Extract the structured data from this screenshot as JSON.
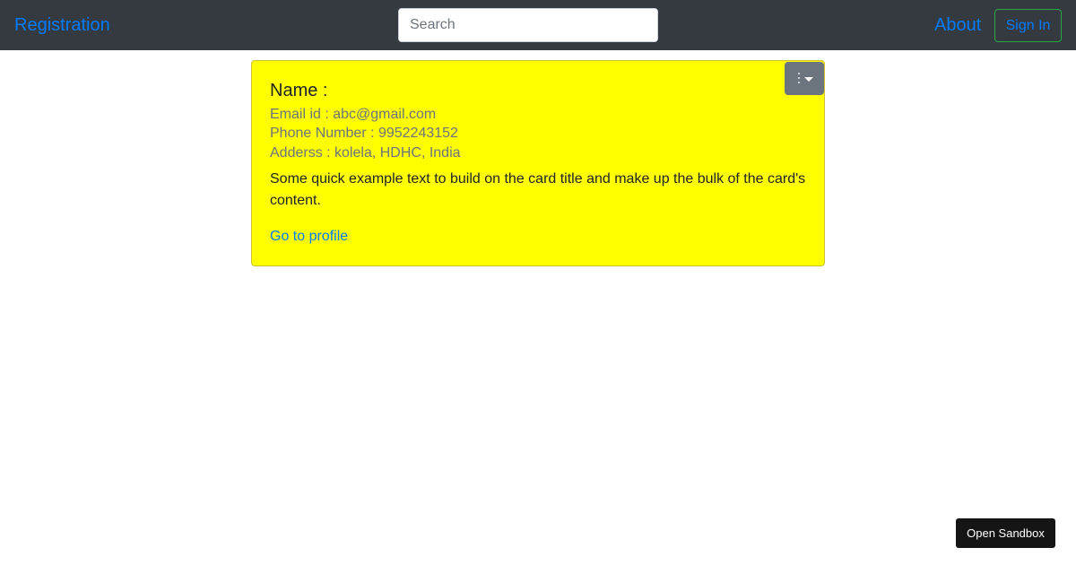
{
  "navbar": {
    "brand": "Registration",
    "search_placeholder": "Search",
    "about": "About",
    "sign_in": "Sign In"
  },
  "card": {
    "title": "Name :",
    "email": "Email id : abc@gmail.com",
    "phone": "Phone Number : 9952243152",
    "address": "Adderss : kolela, HDHC, India",
    "text": "Some quick example text to build on the card title and make up the bulk of the card's content.",
    "link": "Go to profile",
    "background_color": "#ffff00",
    "menu_icons": [
      "kebab-icon",
      "chevron-down-icon"
    ]
  },
  "sandbox": {
    "label": "Open Sandbox"
  },
  "colors": {
    "navbar": "#343a40",
    "link": "#007bff",
    "outline_success": "#28a745",
    "secondary": "#6c757d"
  }
}
